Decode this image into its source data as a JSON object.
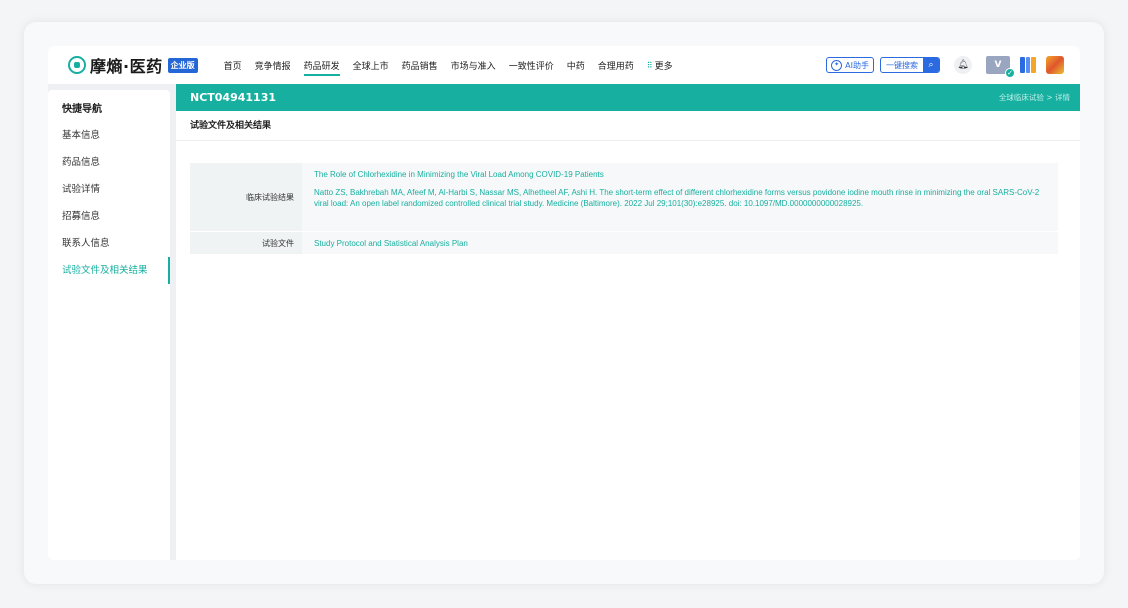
{
  "header": {
    "logo_text": "摩熵·医药",
    "edition": "企业版",
    "nav": [
      "首页",
      "竞争情报",
      "药品研发",
      "全球上市",
      "药品销售",
      "市场与准入",
      "一致性评价",
      "中药",
      "合理用药"
    ],
    "nav_more": "更多",
    "active_nav": "药品研发",
    "ai_label": "AI助手",
    "search_label": "一键搜索"
  },
  "sidebar": {
    "title": "快捷导航",
    "items": [
      {
        "label": "基本信息"
      },
      {
        "label": "药品信息"
      },
      {
        "label": "试验详情"
      },
      {
        "label": "招募信息"
      },
      {
        "label": "联系人信息"
      },
      {
        "label": "试验文件及相关结果"
      }
    ],
    "active_index": 5
  },
  "main": {
    "trial_id": "NCT04941131",
    "breadcrumb": "全球临床试验 > 详情",
    "section_title": "试验文件及相关结果",
    "rows": [
      {
        "label": "临床试验结果",
        "title_link": "The Role of Chlorhexidine in Minimizing the Viral Load Among COVID-19 Patients",
        "citation": "Natto ZS, Bakhrebah MA, Afeef M, Al-Harbi S, Nassar MS, Alhetheel AF, Ashi H. The short-term effect of different chlorhexidine forms versus povidone iodine mouth rinse in minimizing the oral SARS-CoV-2 viral load: An open label randomized controlled clinical trial study. Medicine (Baltimore). 2022 Jul 29;101(30):e28925. doi: 10.1097/MD.0000000000028925."
      },
      {
        "label": "试验文件",
        "title_link": "Study Protocol and Statistical Analysis Plan"
      }
    ]
  },
  "colors": {
    "accent": "#17b0a0",
    "brand_blue": "#2b6ae0"
  }
}
